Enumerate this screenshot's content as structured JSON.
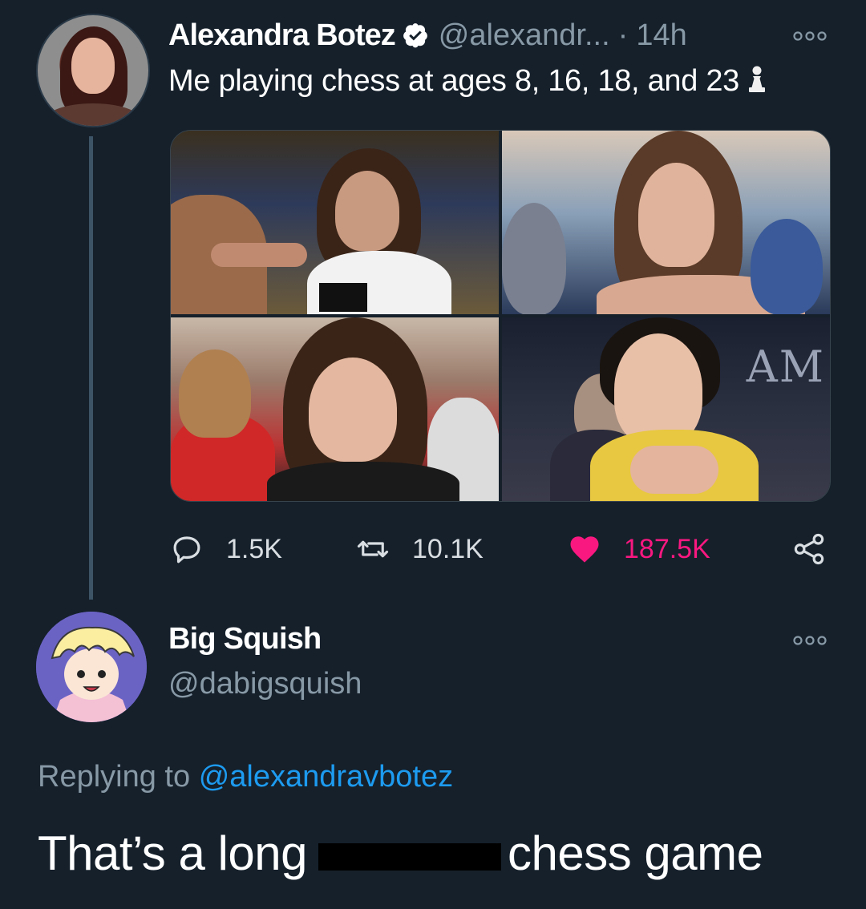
{
  "tweet": {
    "display_name": "Alexandra Botez",
    "handle": "@alexandr...",
    "separator": "·",
    "time": "14h",
    "text": "Me playing chess at ages 8, 16, 18, and 23",
    "emoji_icon": "chess-pawn-icon",
    "verified_icon": "verified-badge-icon",
    "photos": [
      {
        "name": "photo-age-8"
      },
      {
        "name": "photo-age-16"
      },
      {
        "name": "photo-age-18"
      },
      {
        "name": "photo-age-23",
        "overlay_text": "AM"
      }
    ],
    "actions": {
      "replies": "1.5K",
      "retweets": "10.1K",
      "likes": "187.5K"
    }
  },
  "reply": {
    "display_name": "Big Squish",
    "handle": "@dabigsquish",
    "replying_prefix": "Replying to",
    "replying_mention": "@alexandravbotez",
    "text_before": "That’s a long",
    "text_after": "chess game"
  },
  "colors": {
    "background": "#15202b",
    "secondary_text": "#8899a6",
    "link": "#1d9bf0",
    "like": "#f91880",
    "thread_line": "#3d5466"
  }
}
